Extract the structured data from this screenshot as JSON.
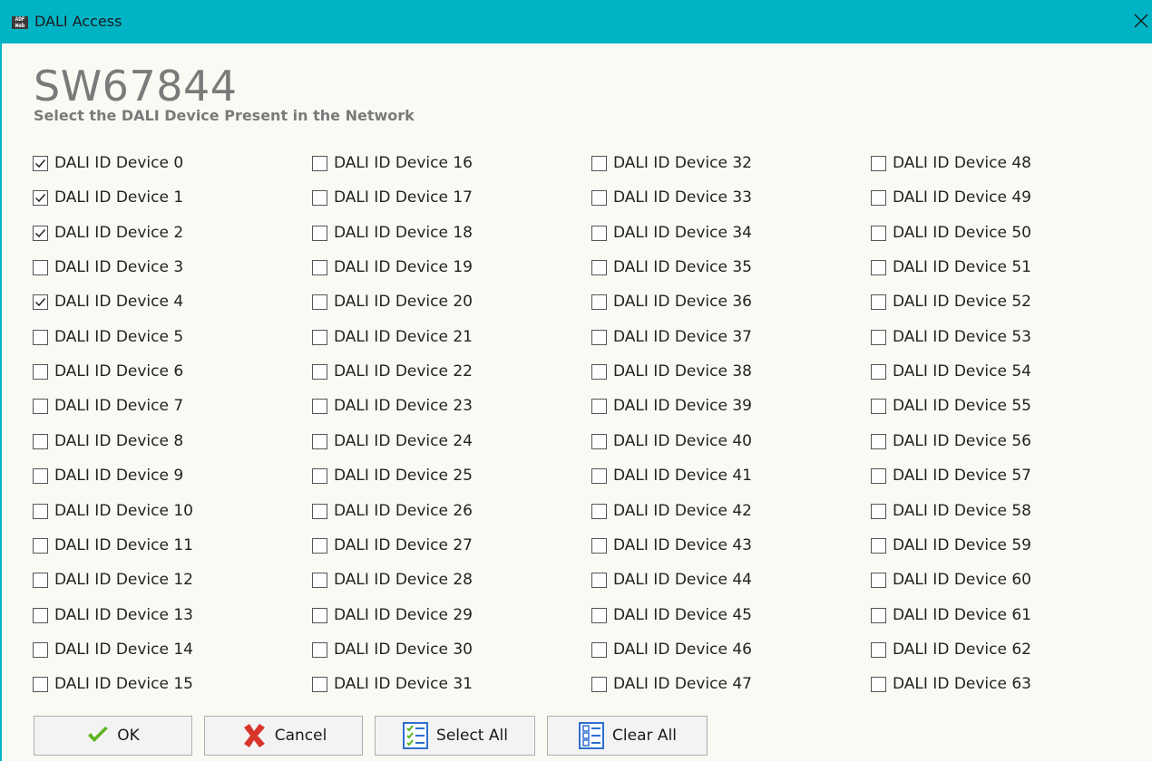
{
  "window": {
    "title": "DALI Access",
    "icon_text": "ADF\nWeb"
  },
  "header": {
    "title": "SW67844",
    "subtitle": "Select the DALI Device Present in the  Network"
  },
  "devices": {
    "label_prefix": "DALI ID Device ",
    "count": 64,
    "rows_per_column": 16,
    "checked": [
      0,
      1,
      2,
      4
    ]
  },
  "buttons": {
    "ok": "OK",
    "cancel": "Cancel",
    "select_all": "Select All",
    "clear_all": "Clear All"
  },
  "colors": {
    "titlebar": "#00B4C6",
    "ok_check": "#5DB31E",
    "cancel_x": "#D8342B",
    "list_icon": "#2F6FD0"
  }
}
